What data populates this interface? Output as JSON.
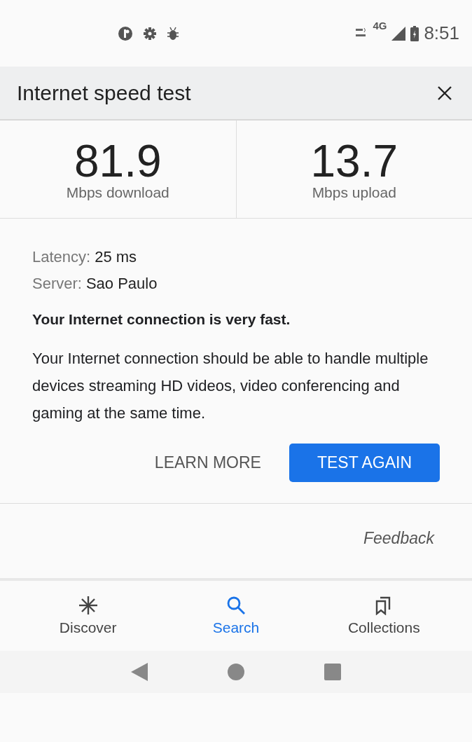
{
  "status_bar": {
    "network": "4G",
    "time": "8:51"
  },
  "header": {
    "title": "Internet speed test"
  },
  "results": [
    {
      "value": "81.9",
      "unit": "Mbps download"
    },
    {
      "value": "13.7",
      "unit": "Mbps upload"
    }
  ],
  "details": [
    {
      "label": "Latency:",
      "value": "25 ms"
    },
    {
      "label": "Server:",
      "value": "Sao Paulo"
    }
  ],
  "verdict": "Your Internet connection is very fast.",
  "description": "Your Internet connection should be able to handle multiple devices streaming HD videos, video conferencing and gaming at the same time.",
  "actions": [
    {
      "label": "LEARN MORE",
      "kind": "text"
    },
    {
      "label": "TEST AGAIN",
      "kind": "primary"
    }
  ],
  "feedback": "Feedback",
  "bottom_nav": [
    {
      "label": "Discover",
      "kind": "discover",
      "selected": false
    },
    {
      "label": "Search",
      "kind": "search",
      "selected": true
    },
    {
      "label": "Collections",
      "kind": "collections",
      "selected": false
    }
  ]
}
